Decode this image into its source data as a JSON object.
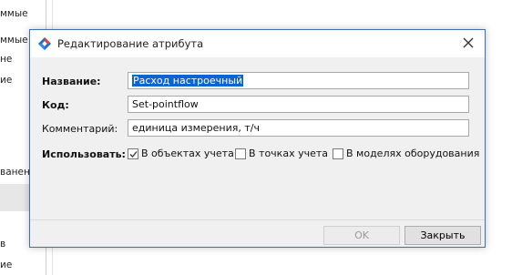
{
  "background": {
    "fragments": [
      "ммые",
      "ммые",
      "не",
      "ие",
      "ванени",
      "в",
      "ие"
    ]
  },
  "dialog": {
    "title": "Редактирование атрибута",
    "fields": {
      "name_label": "Название:",
      "name_value": "Расход настроечный",
      "code_label": "Код:",
      "code_value": "Set-pointflow",
      "comment_label": "Комментарий:",
      "comment_value": "единица измерения, т/ч"
    },
    "usage": {
      "label": "Использовать:",
      "options": [
        {
          "label": "В объектах учета",
          "checked": true
        },
        {
          "label": "В точках учета",
          "checked": false
        },
        {
          "label": "В моделях оборудования",
          "checked": false
        }
      ]
    },
    "buttons": {
      "ok": "OK",
      "close": "Закрыть"
    }
  },
  "colors": {
    "selection": "#0a64d2",
    "border_accent": "#3f6fb5"
  }
}
